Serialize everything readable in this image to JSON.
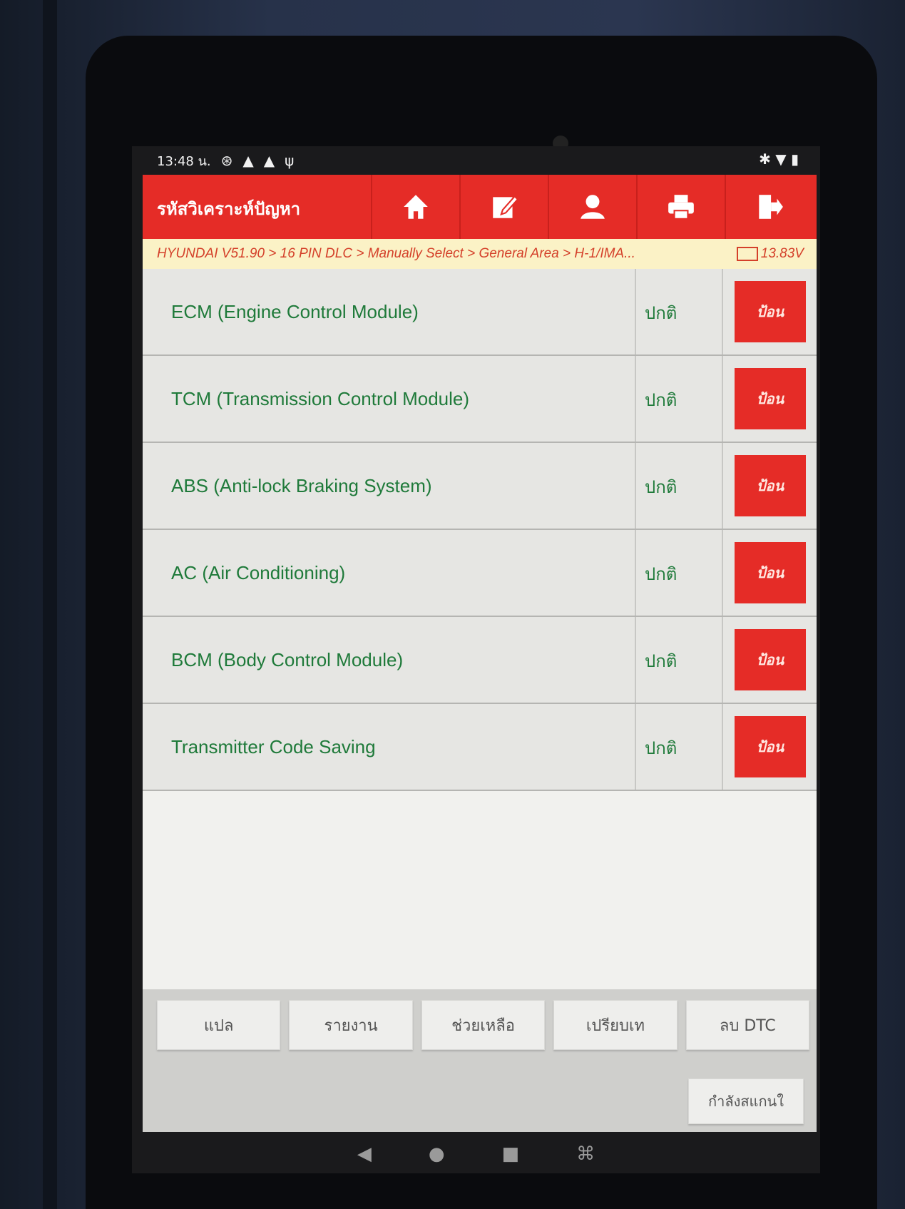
{
  "status_bar": {
    "time": "13:48 น.",
    "icons": [
      "accessibility-icon",
      "warning-icon",
      "warning-icon",
      "usb-icon"
    ],
    "right_icons": [
      "bluetooth-icon",
      "wifi-icon",
      "battery-icon"
    ]
  },
  "header": {
    "title": "รหัสวิเคราะห์ปัญหา",
    "toolbar": [
      {
        "icon": "home-icon"
      },
      {
        "icon": "edit-icon"
      },
      {
        "icon": "user-icon"
      },
      {
        "icon": "print-icon"
      },
      {
        "icon": "exit-icon"
      }
    ]
  },
  "breadcrumb": {
    "path": "HYUNDAI V51.90 > 16 PIN DLC > Manually Select > General Area > H-1/IMA...",
    "voltage": "13.83V"
  },
  "systems": [
    {
      "name": "ECM (Engine Control Module)",
      "status": "ปกติ",
      "action": "ป้อน"
    },
    {
      "name": "TCM (Transmission Control Module)",
      "status": "ปกติ",
      "action": "ป้อน"
    },
    {
      "name": "ABS (Anti-lock Braking System)",
      "status": "ปกติ",
      "action": "ป้อน"
    },
    {
      "name": "AC (Air Conditioning)",
      "status": "ปกติ",
      "action": "ป้อน"
    },
    {
      "name": "BCM (Body Control Module)",
      "status": "ปกติ",
      "action": "ป้อน"
    },
    {
      "name": "Transmitter Code Saving",
      "status": "ปกติ",
      "action": "ป้อน"
    }
  ],
  "footer": {
    "buttons": [
      "แปล",
      "รายงาน",
      "ช่วยเหลือ",
      "เปรียบเท",
      "ลบ DTC"
    ],
    "scan_label": "กำลังสแกนใ"
  },
  "colors": {
    "accent": "#e52c27",
    "status_text": "#1f7a3a",
    "breadcrumb_text": "#d4402a",
    "breadcrumb_bg": "#fbf2c6"
  }
}
